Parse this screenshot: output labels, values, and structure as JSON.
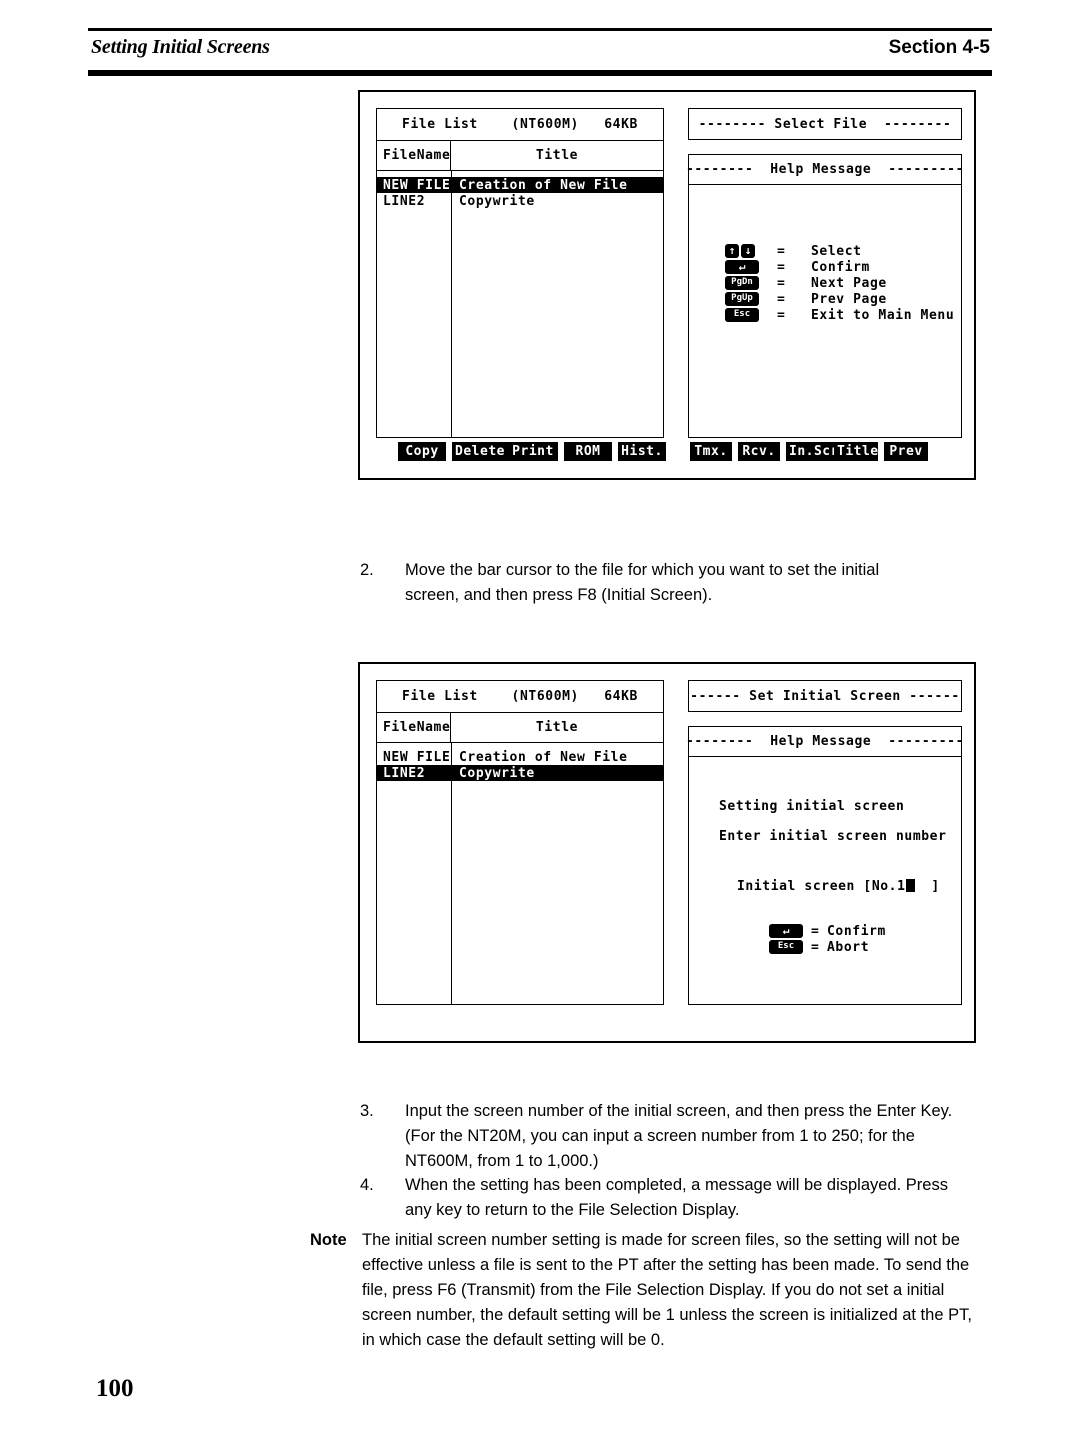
{
  "header": {
    "left_title": "Setting Initial Screens",
    "right_title": "Section 4-5"
  },
  "page_number": "100",
  "screens": [
    {
      "id": "select-file",
      "file_list": {
        "title_line": "File List    (NT600M)   64KB",
        "columns": {
          "name": "FileName",
          "title": "Title"
        },
        "rows": [
          {
            "name": "NEW FILE",
            "title": "Creation of New File",
            "selected": true
          },
          {
            "name": "LINE2",
            "title": "Copywrite",
            "selected": false
          }
        ]
      },
      "mode_banner": "-------- Select File  --------",
      "help_banner": "--------  Help Message  ---------",
      "help_rows": [
        {
          "keys": [
            "arrow-up",
            "arrow-down"
          ],
          "eq": "=",
          "label": "Select"
        },
        {
          "keys": [
            "enter"
          ],
          "eq": "=",
          "label": "Confirm"
        },
        {
          "keys": [
            "pgdn"
          ],
          "eq": "=",
          "label": "Next Page"
        },
        {
          "keys": [
            "pgup"
          ],
          "eq": "=",
          "label": "Prev Page"
        },
        {
          "keys": [
            "esc"
          ],
          "eq": "=",
          "label": "Exit to Main Menu"
        }
      ],
      "fkeys_left": [
        "Copy",
        "Delete",
        "Print",
        "ROM",
        "Hist."
      ],
      "fkeys_right": [
        "Tmx.",
        "Rcv.",
        "In.Scr",
        "Title",
        "Prev"
      ]
    },
    {
      "id": "set-initial-screen",
      "file_list": {
        "title_line": "File List    (NT600M)   64KB",
        "columns": {
          "name": "FileName",
          "title": "Title"
        },
        "rows": [
          {
            "name": "NEW FILE",
            "title": "Creation of New File",
            "selected": false
          },
          {
            "name": "LINE2",
            "title": "Copywrite",
            "selected": true
          }
        ]
      },
      "mode_banner": "------ Set Initial Screen ------",
      "help_banner": "--------  Help Message  ---------",
      "messages": [
        "Setting initial screen",
        "Enter initial screen number"
      ],
      "input_label_prefix": "Initial screen [No.1",
      "input_label_suffix": "  ]",
      "help_rows": [
        {
          "keys": [
            "enter"
          ],
          "eq": "=",
          "label": "Confirm"
        },
        {
          "keys": [
            "esc"
          ],
          "eq": "=",
          "label": "Abort"
        }
      ]
    }
  ],
  "keycaps": {
    "arrow-up": "↑",
    "arrow-down": "↓",
    "enter": "↵",
    "pgdn": "PgDn",
    "pgup": "PgUp",
    "esc": "Esc"
  },
  "steps": [
    {
      "num": "2.",
      "text": "Move the bar cursor to the file for which you want to set the initial screen, and then press F8 (Initial Screen)."
    },
    {
      "num": "3.",
      "text": "Input the screen number of the initial screen, and then press the Enter Key. (For the NT20M, you can input a screen number from 1 to 250; for the NT600M, from 1 to 1,000.)"
    },
    {
      "num": "4.",
      "text": "When the setting has been completed, a message will be displayed. Press any key to return to the File Selection Display."
    }
  ],
  "note": {
    "label": "Note",
    "text": "The initial screen number setting is made for screen files, so the setting will not be effective unless a file is sent to the PT after the setting has been made. To send the file, press F6 (Transmit) from the File Selection Display. If you do not set a initial screen number, the default setting will be 1 unless the screen is initialized at the PT, in which case the default setting will be 0."
  }
}
